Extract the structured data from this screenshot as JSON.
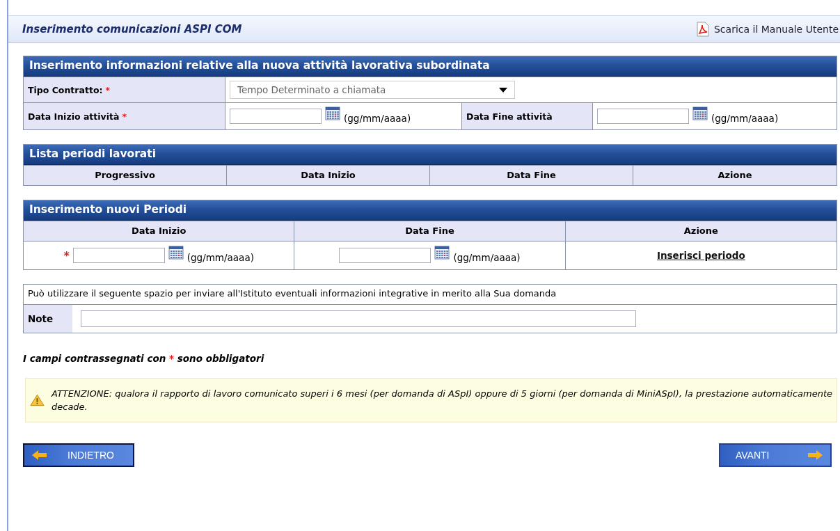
{
  "header": {
    "title": "Inserimento comunicazioni ASPI COM",
    "manual_link": "Scarica il Manuale Utente"
  },
  "activity": {
    "title": "Inserimento informazioni relative alla nuova attività lavorativa subordinata",
    "contract": {
      "label": "Tipo Contratto:",
      "mark": "*",
      "value": "Tempo Determinato a chiamata"
    },
    "start": {
      "label": "Data Inizio attività",
      "mark": "*",
      "hint": "(gg/mm/aaaa)"
    },
    "end": {
      "label": "Data Fine attività",
      "hint": "(gg/mm/aaaa)"
    }
  },
  "periods": {
    "title": "Lista periodi lavorati",
    "columns": [
      "Progressivo",
      "Data Inizio",
      "Data Fine",
      "Azione"
    ]
  },
  "new_periods": {
    "title": "Inserimento nuovi Periodi",
    "columns": [
      "Data Inizio",
      "Data Fine",
      "Azione"
    ],
    "start": {
      "mark": "*",
      "hint": "(gg/mm/aaaa)"
    },
    "end": {
      "hint": "(gg/mm/aaaa)"
    },
    "action": "Inserisci periodo"
  },
  "notes": {
    "intro": "Può utilizzare il seguente spazio per inviare all'Istituto eventuali informazioni integrative in merito alla Sua domanda",
    "label": "Note"
  },
  "required_note": {
    "before": "I campi contrassegnati con",
    "mark": "*",
    "after": "sono obbligatori"
  },
  "warning": "ATTENZIONE: qualora il rapporto di lavoro comunicato superi i 6 mesi (per domanda di ASpI) oppure di 5 giorni (per domanda di MiniASpI), la prestazione automaticamente decade.",
  "buttons": {
    "back": "INDIETRO",
    "next": "AVANTI"
  }
}
